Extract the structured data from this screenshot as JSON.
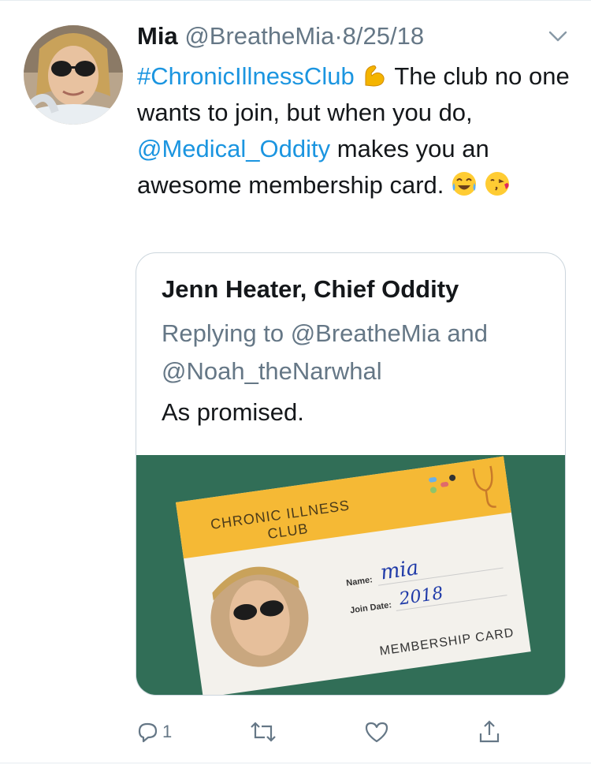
{
  "tweet": {
    "author_name": "Mia",
    "handle": "@BreatheMia",
    "separator": "·",
    "date": "8/25/18",
    "hashtag": "#ChronicIllnessClub",
    "text_part1": "The club no one wants to join, but when you do,",
    "mention": "@Medical_Oddity",
    "text_part2": "makes you an awesome membership card.",
    "emojis_inline": [
      "flexed-biceps-icon",
      "joy-icon",
      "kissing-heart-icon"
    ]
  },
  "quoted": {
    "author_name": "Jenn Heater, Chief Oddity",
    "replying_to_label": "Replying to @BreatheMia and",
    "replying_to_line2": "@Noah_theNarwhal",
    "text": "As promised.",
    "card": {
      "title_line1": "CHRONIC ILLNESS",
      "title_line2": "CLUB",
      "name_label": "Name:",
      "name_value": "mia",
      "join_label": "Join Date:",
      "join_value": "2018",
      "footer": "MEMBERSHIP CARD"
    }
  },
  "actions": {
    "reply_count": "1"
  },
  "colors": {
    "link": "#1b95e0",
    "muted": "#657786",
    "card_yellow": "#f5b935",
    "background_green": "#2f6d55"
  }
}
